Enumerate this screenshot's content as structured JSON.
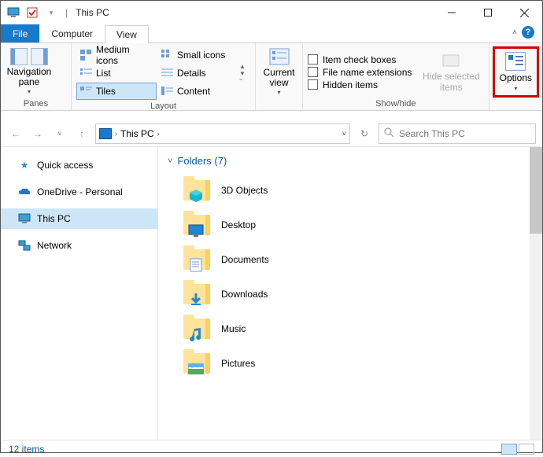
{
  "titlebar": {
    "title": "This PC"
  },
  "tabs": {
    "file": "File",
    "computer": "Computer",
    "view": "View"
  },
  "ribbon": {
    "panes": {
      "navigation": "Navigation\npane",
      "label": "Panes"
    },
    "layout": {
      "medium": "Medium icons",
      "small": "Small icons",
      "list": "List",
      "details": "Details",
      "tiles": "Tiles",
      "content": "Content",
      "label": "Layout"
    },
    "currentview": {
      "button": "Current\nview",
      "label": ""
    },
    "showhide": {
      "check_boxes": "Item check boxes",
      "file_ext": "File name extensions",
      "hidden": "Hidden items",
      "hide_selected": "Hide selected\nitems",
      "label": "Show/hide"
    },
    "options": "Options"
  },
  "address": {
    "location": "This PC"
  },
  "search": {
    "placeholder": "Search This PC"
  },
  "sidebar": {
    "quick": "Quick access",
    "onedrive": "OneDrive - Personal",
    "thispc": "This PC",
    "network": "Network"
  },
  "folders": {
    "header": "Folders (7)",
    "items": [
      {
        "label": "3D Objects"
      },
      {
        "label": "Desktop"
      },
      {
        "label": "Documents"
      },
      {
        "label": "Downloads"
      },
      {
        "label": "Music"
      },
      {
        "label": "Pictures"
      }
    ]
  },
  "status": {
    "items": "12 items"
  }
}
